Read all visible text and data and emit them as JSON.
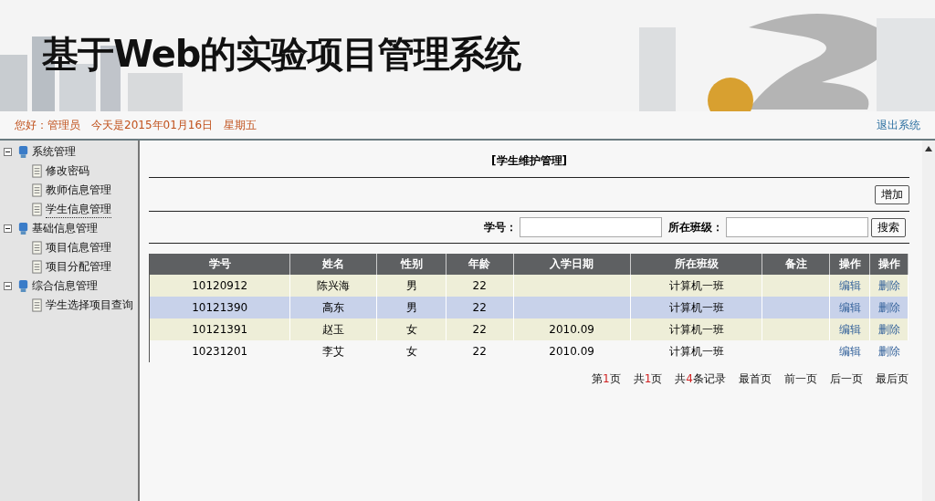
{
  "header": {
    "title": "基于Web的实验项目管理系统",
    "greeting": "您好：管理员　今天是2015年01月16日　星期五",
    "logout": "退出系统"
  },
  "sidebar": {
    "items": [
      {
        "label": "系统管理",
        "expanded": true,
        "children": [
          {
            "label": "修改密码",
            "selected": false
          },
          {
            "label": "教师信息管理",
            "selected": false
          },
          {
            "label": "学生信息管理",
            "selected": true
          }
        ]
      },
      {
        "label": "基础信息管理",
        "expanded": true,
        "children": [
          {
            "label": "项目信息管理",
            "selected": false
          },
          {
            "label": "项目分配管理",
            "selected": false
          }
        ]
      },
      {
        "label": "综合信息管理",
        "expanded": true,
        "children": [
          {
            "label": "学生选择项目查询",
            "selected": false
          }
        ]
      }
    ]
  },
  "panel": {
    "title": "[学生维护管理]",
    "add_button": "增加",
    "search": {
      "id_label": "学号：",
      "class_label": "所在班级：",
      "button": "搜索"
    }
  },
  "table": {
    "columns": [
      "学号",
      "姓名",
      "性别",
      "年龄",
      "入学日期",
      "所在班级",
      "备注",
      "操作",
      "操作"
    ],
    "rows": [
      {
        "selected": false,
        "cells": [
          "10120912",
          "陈兴海",
          "男",
          "22",
          "",
          "计算机一班",
          ""
        ],
        "edit": "编辑",
        "delete": "删除"
      },
      {
        "selected": true,
        "cells": [
          "10121390",
          "高东",
          "男",
          "22",
          "",
          "计算机一班",
          ""
        ],
        "edit": "编辑",
        "delete": "删除"
      },
      {
        "selected": false,
        "cells": [
          "10121391",
          "赵玉",
          "女",
          "22",
          "2010.09",
          "计算机一班",
          ""
        ],
        "edit": "编辑",
        "delete": "删除"
      },
      {
        "selected": false,
        "cells": [
          "10231201",
          "李艾",
          "女",
          "22",
          "2010.09",
          "计算机一班",
          ""
        ],
        "edit": "编辑",
        "delete": "删除"
      }
    ]
  },
  "pager": [
    {
      "pre": "第",
      "num": "1",
      "post": "页"
    },
    {
      "pre": "共",
      "num": "1",
      "post": "页"
    },
    {
      "pre": "共",
      "num": "4",
      "post": "条记录"
    },
    {
      "pre": "最首页"
    },
    {
      "pre": "前一页"
    },
    {
      "pre": "后一页"
    },
    {
      "pre": "最后页"
    }
  ]
}
